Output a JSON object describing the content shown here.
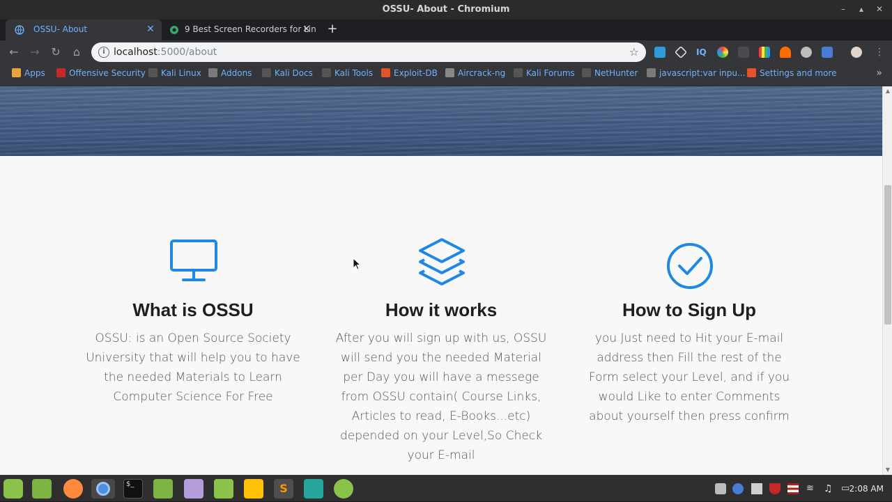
{
  "window": {
    "title": "OSSU- About - Chromium"
  },
  "tabs": [
    {
      "label": "OSSU- About",
      "active": true
    },
    {
      "label": "9 Best Screen Recorders for Lin",
      "active": false
    }
  ],
  "toolbar": {
    "url_host": "localhost",
    "url_path": ":5000/about"
  },
  "bookmarks": [
    {
      "label": "Apps",
      "icon": "apps-grid-icon",
      "color": "#e8a33d"
    },
    {
      "label": "Offensive Security",
      "icon": "offsec-icon",
      "color": "#c62828"
    },
    {
      "label": "Kali Linux",
      "icon": "kali-dragon-icon",
      "color": "#555555"
    },
    {
      "label": "Addons",
      "icon": "globe-icon",
      "color": "#7a7a7a"
    },
    {
      "label": "Kali Docs",
      "icon": "kali-dragon-icon",
      "color": "#555555"
    },
    {
      "label": "Kali Tools",
      "icon": "kali-dragon-icon",
      "color": "#555555"
    },
    {
      "label": "Exploit-DB",
      "icon": "exploitdb-icon",
      "color": "#e0542a"
    },
    {
      "label": "Aircrack-ng",
      "icon": "aircrack-icon",
      "color": "#888888"
    },
    {
      "label": "Kali Forums",
      "icon": "kali-dragon-icon",
      "color": "#555555"
    },
    {
      "label": "NetHunter",
      "icon": "kali-dragon-icon",
      "color": "#555555"
    },
    {
      "label": "javascript:var inpu...",
      "icon": "globe-icon",
      "color": "#7a7a7a"
    },
    {
      "label": "Settings and more",
      "icon": "soundcloud-icon",
      "color": "#e5532d"
    }
  ],
  "features": [
    {
      "icon": "monitor-icon",
      "title": "What is OSSU",
      "text": "OSSU: is an Open Source Society University that will help you to have the needed Materials to Learn Computer Science For Free"
    },
    {
      "icon": "layers-icon",
      "title": "How it works",
      "text": "After you will sign up with us, OSSU will send you the needed Material per Day you will have a messege from OSSU contain( Course Links, Articles to read, E-Books...etc) depended on your Level,So Check your E-mail"
    },
    {
      "icon": "check-circle-icon",
      "title": "How to Sign Up",
      "text": "you Just need to Hit your E-mail address then Fill the rest of the Form select your Level, and if you would Like to enter Comments about yourself then press confirm"
    }
  ],
  "colors": {
    "accent_icon": "#1e88e5",
    "tab_text": "#6fb3ff"
  },
  "taskbar": {
    "clock": "2:08 AM"
  }
}
